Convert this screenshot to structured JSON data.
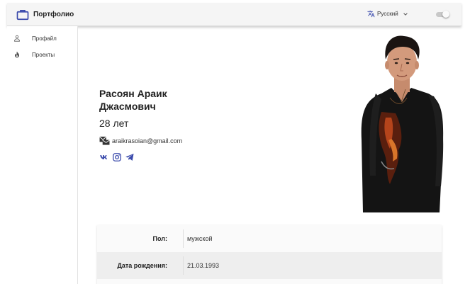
{
  "header": {
    "title": "Портфолио",
    "language": "Русский"
  },
  "sidebar": {
    "items": [
      {
        "label": "Профайл"
      },
      {
        "label": "Проекты"
      }
    ]
  },
  "profile": {
    "name": "Расоян Араик Джасмович",
    "age": "28 лет",
    "email": "araikrasoian@gmail.com"
  },
  "info": [
    {
      "label": "Пол:",
      "value": "мужской"
    },
    {
      "label": "Дата рождения:",
      "value": "21.03.1993"
    }
  ],
  "colors": {
    "accent": "#3949ab",
    "topbar": "#f5f5f5",
    "row_alt": "#eeeeee"
  }
}
